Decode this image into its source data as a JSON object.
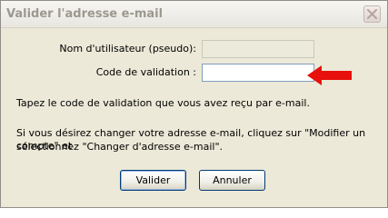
{
  "dialog": {
    "title": "Valider l'adresse e-mail",
    "close_icon": "close-icon"
  },
  "form": {
    "username_label": "Nom d'utilisateur (pseudo):",
    "username_value": "",
    "code_label": "Code de validation :",
    "code_value": "",
    "arrow_icon": "red-arrow-left-icon",
    "arrow_color": "#e8100c"
  },
  "info": {
    "line1": "Tapez le code de validation que vous avez reçu par e-mail.",
    "line2": "Si vous désirez changer votre adresse e-mail, cliquez sur \"Modifier un compte\" et",
    "line3": "sélectionnez \"Changer d'adresse e-mail\"."
  },
  "buttons": {
    "ok_label": "Valider",
    "cancel_label": "Annuler"
  }
}
